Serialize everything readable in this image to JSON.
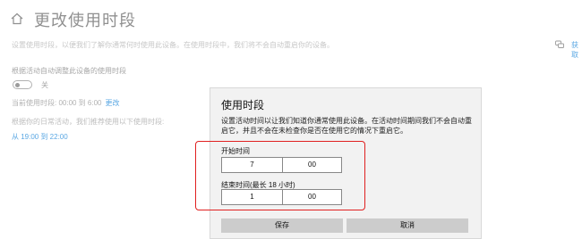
{
  "header": {
    "title": "更改使用时段"
  },
  "description": "设置使用时段，以便我们了解你通常何时使用此设备。在使用时段中，我们将不会自动重启你的设备。",
  "help": {
    "label": "获取"
  },
  "auto_adjust": {
    "label": "根据活动自动调整此设备的使用时段",
    "toggle_state": "关"
  },
  "current_hours": {
    "text": "当前使用时段: 00:00 到 6:00",
    "change_link": "更改"
  },
  "recommendation": {
    "text": "根据你的日常活动，我们推荐使用以下使用时段:",
    "range": "从 19:00 到 22:00"
  },
  "dialog": {
    "title": "使用时段",
    "description": "设置活动时间以让我们知道你通常使用此设备。在活动时间期间我们不会自动重启它，并且不会在未检查你是否在使用它的情况下重启它。",
    "start": {
      "label": "开始时间",
      "hour": "7",
      "minute": "00"
    },
    "end": {
      "label": "结束时间(最长 18 小时)",
      "hour": "1",
      "minute": "00"
    },
    "save_label": "保存",
    "cancel_label": "取消"
  },
  "colors": {
    "accent": "#0078d4",
    "highlight": "#e02020"
  }
}
